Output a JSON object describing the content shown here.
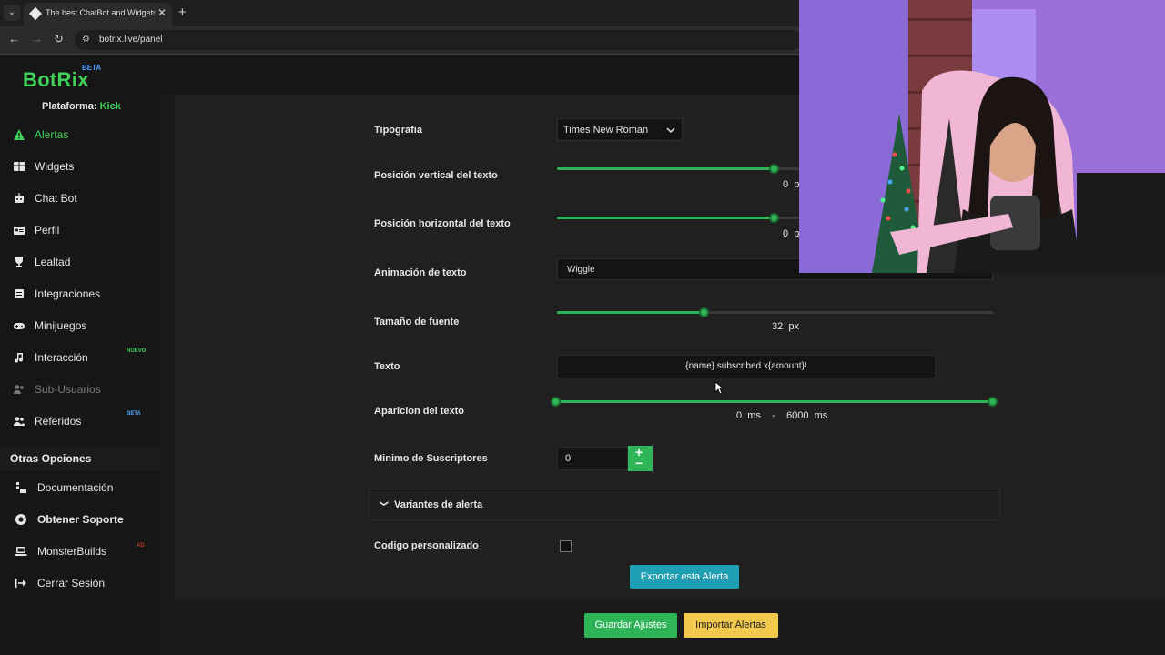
{
  "browser": {
    "tab_title": "The best ChatBot and Widgets",
    "close_glyph": "✕",
    "new_tab_glyph": "+",
    "url": "botrix.live/panel",
    "back_glyph": "←",
    "forward_glyph": "→",
    "reload_glyph": "↻",
    "site_info_glyph": "⚙",
    "tab_menu_glyph": "⌄"
  },
  "logo": {
    "name": "BotRix",
    "badge": "BETA"
  },
  "platform": {
    "label": "Plataforma:",
    "value": "Kick"
  },
  "sidebar": {
    "items": [
      {
        "label": "Alertas",
        "icon": "warning-icon",
        "active": true
      },
      {
        "label": "Widgets",
        "icon": "grid-icon"
      },
      {
        "label": "Chat Bot",
        "icon": "robot-icon"
      },
      {
        "label": "Perfil",
        "icon": "id-card-icon"
      },
      {
        "label": "Lealtad",
        "icon": "trophy-icon"
      },
      {
        "label": "Integraciones",
        "icon": "puzzle-icon"
      },
      {
        "label": "Minijuegos",
        "icon": "gamepad-icon"
      },
      {
        "label": "Interacción",
        "icon": "music-note-icon",
        "badge": "NUEVO"
      },
      {
        "label": "Sub-Usuarios",
        "icon": "users-icon",
        "disabled": true
      },
      {
        "label": "Referidos",
        "icon": "user-group-icon",
        "badge": "BETA"
      }
    ],
    "other_header": "Otras Opciones",
    "other_items": [
      {
        "label": "Documentación",
        "icon": "book-icon"
      },
      {
        "label": "Obtener Soporte",
        "icon": "support-icon"
      },
      {
        "label": "MonsterBuilds",
        "icon": "laptop-icon",
        "badge": "AD"
      },
      {
        "label": "Cerrar Sesión",
        "icon": "logout-icon"
      }
    ]
  },
  "form": {
    "typography": {
      "label": "Tipografia",
      "value": "Times New Roman"
    },
    "vertical_position": {
      "label": "Posición vertical del texto",
      "value": "0",
      "unit": "px",
      "fraction": 0.5
    },
    "horizontal_position": {
      "label": "Posición horizontal del texto",
      "value": "0",
      "unit": "px",
      "fraction": 0.5
    },
    "text_animation": {
      "label": "Animación de texto",
      "value": "Wiggle"
    },
    "font_size": {
      "label": "Tamaño de fuente",
      "value": "32",
      "unit": "px",
      "fraction": 0.34
    },
    "text": {
      "label": "Texto",
      "value": "{name} subscribed x{amount}!"
    },
    "text_appearance": {
      "label": "Aparicion del texto",
      "min": "0",
      "max": "6000",
      "unit": "ms",
      "separator": "-"
    },
    "min_subs": {
      "label": "Minimo de Suscriptores",
      "value": "0",
      "plus": "+",
      "minus": "−"
    },
    "variants": {
      "label": "Variantes de alerta",
      "chevron": "❯"
    },
    "custom_code": {
      "label": "Codigo personalizado",
      "checked": false
    },
    "export_button": "Exportar esta Alerta",
    "save_button": "Guardar Ajustes",
    "import_button": "Importar Alertas"
  },
  "colors": {
    "accent": "#2fb457",
    "brand": "#3fd159",
    "export": "#1e9fb3",
    "import": "#f2c94c"
  }
}
